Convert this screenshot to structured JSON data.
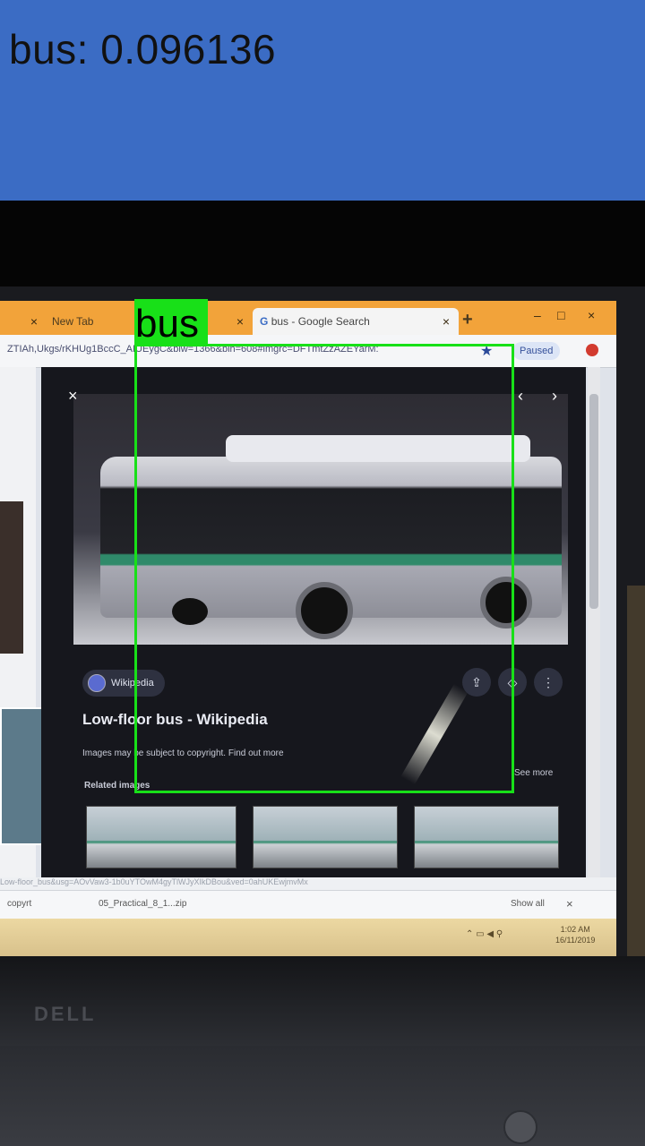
{
  "result": {
    "text": "bus: 0.096136"
  },
  "detection": {
    "label": "bus",
    "score": 0.096136,
    "box_color": "#18e018"
  },
  "photo": {
    "browser": {
      "tabs": [
        {
          "label": "",
          "active": false
        },
        {
          "label": "New Tab",
          "active": false
        },
        {
          "label": "bus - Google Search",
          "active": true
        }
      ],
      "url": "ZTIAh,Ukgs/rKHUg1BccC_AIUEygC&biw=1366&bih=608#imgrc=DFTmtZzAZEYarM:",
      "paused_label": "Paused",
      "viewer": {
        "source": "Wikipedia",
        "title": "Low-floor bus - Wikipedia",
        "copyright": "Images may be subject to copyright.",
        "find_out_more": "Find out more",
        "related_label": "Related images",
        "see_more": "See more"
      },
      "status_url": "Low-floor_bus&usg=AOvVaw3-1b0uYTOwM4gyTlWJyXIkDBou&ved=0ahUKEwjmvMx",
      "downloads": {
        "item": "copyrt",
        "file": "05_Practical_8_1...zip",
        "show_all": "Show all"
      },
      "clock": [
        "1:02 AM",
        "16/11/2019"
      ]
    },
    "laptop_brand": "DELL"
  },
  "colors": {
    "result_bar": "#3b6cc4",
    "detection_green": "#18e018"
  }
}
